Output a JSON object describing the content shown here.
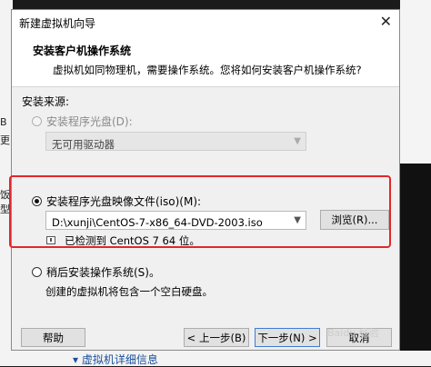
{
  "background": {
    "left_fragments": [
      "B",
      "更"
    ],
    "left_fragments_lower": [
      "饭",
      "型"
    ],
    "bottom_link": "▾ 虚拟机详细信息"
  },
  "dialog": {
    "title": "新建虚拟机向导",
    "close_symbol": "✕",
    "header": {
      "title": "安装客户机操作系统",
      "subtitle": "虚拟机如同物理机，需要操作系统。您将如何安装客户机操作系统?"
    },
    "source_label": "安装来源:",
    "option_disc": {
      "label": "安装程序光盘(D):",
      "drive_value": "无可用驱动器"
    },
    "option_iso": {
      "label": "安装程序光盘映像文件(iso)(M):",
      "path_value": "D:\\xunji\\CentOS-7-x86_64-DVD-2003.iso",
      "browse_label": "浏览(R)...",
      "detected_text": "已检测到 CentOS 7 64 位。"
    },
    "option_later": {
      "label": "稍后安装操作系统(S)。",
      "description": "创建的虚拟机将包含一个空白硬盘。"
    },
    "footer": {
      "help_label": "帮助",
      "back_label": "< 上一步(B)",
      "next_label": "下一步(N) >",
      "cancel_label": "取消"
    }
  },
  "watermark": "Baidu 经验"
}
